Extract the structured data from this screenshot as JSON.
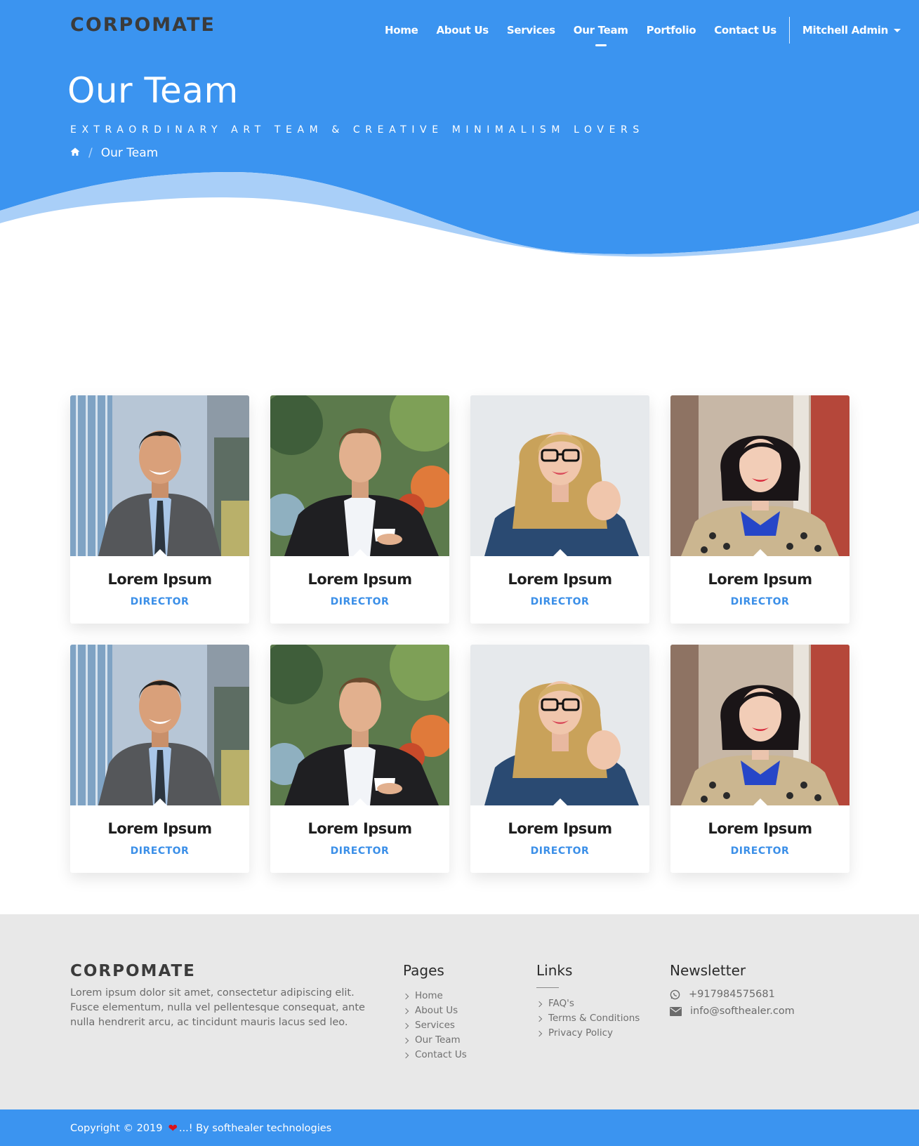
{
  "brand": {
    "name": "CORPOMATE"
  },
  "nav": {
    "items": [
      {
        "label": "Home",
        "active": false
      },
      {
        "label": "About Us",
        "active": false
      },
      {
        "label": "Services",
        "active": false
      },
      {
        "label": "Our Team",
        "active": true
      },
      {
        "label": "Portfolio",
        "active": false
      },
      {
        "label": "Contact Us",
        "active": false
      }
    ],
    "user": "Mitchell Admin"
  },
  "hero": {
    "title": "Our Team",
    "subtitle": "EXTRAORDINARY ART TEAM & CREATIVE MINIMALISM LOVERS",
    "breadcrumb_current": "Our Team"
  },
  "team": [
    {
      "name": "Lorem Ipsum",
      "role": "DIRECTOR",
      "photo": "man-smiling-grey-suit"
    },
    {
      "name": "Lorem Ipsum",
      "role": "DIRECTOR",
      "photo": "man-black-suit-coffee"
    },
    {
      "name": "Lorem Ipsum",
      "role": "DIRECTOR",
      "photo": "woman-glasses-denim"
    },
    {
      "name": "Lorem Ipsum",
      "role": "DIRECTOR",
      "photo": "woman-bob-hair"
    },
    {
      "name": "Lorem Ipsum",
      "role": "DIRECTOR",
      "photo": "man-smiling-grey-suit"
    },
    {
      "name": "Lorem Ipsum",
      "role": "DIRECTOR",
      "photo": "man-black-suit-coffee"
    },
    {
      "name": "Lorem Ipsum",
      "role": "DIRECTOR",
      "photo": "woman-glasses-denim"
    },
    {
      "name": "Lorem Ipsum",
      "role": "DIRECTOR",
      "photo": "woman-bob-hair"
    }
  ],
  "footer": {
    "brand": "CORPOMATE",
    "about": "Lorem ipsum dolor sit amet, consectetur adipiscing elit. Fusce elementum, nulla vel pellentesque consequat, ante nulla hendrerit arcu, ac tincidunt mauris lacus sed leo.",
    "pages": {
      "title": "Pages",
      "items": [
        "Home",
        "About Us",
        "Services",
        "Our Team",
        "Contact Us"
      ]
    },
    "links": {
      "title": "Links",
      "items": [
        "FAQ's",
        "Terms & Conditions",
        "Privacy Policy"
      ]
    },
    "newsletter": {
      "title": "Newsletter",
      "phone": "+917984575681",
      "email": "info@softhealer.com"
    },
    "copyright_prefix": "Copyright © 2019",
    "copyright_suffix": "...! By softhealer technologies"
  },
  "colors": {
    "primary": "#3b94f0",
    "accent_text": "#3b8fe8",
    "footer_bg": "#e8e8e8"
  },
  "icons": [
    "home-icon",
    "whatsapp-icon",
    "envelope-icon",
    "heart-icon",
    "chevron-right-icon",
    "caret-down-icon"
  ]
}
